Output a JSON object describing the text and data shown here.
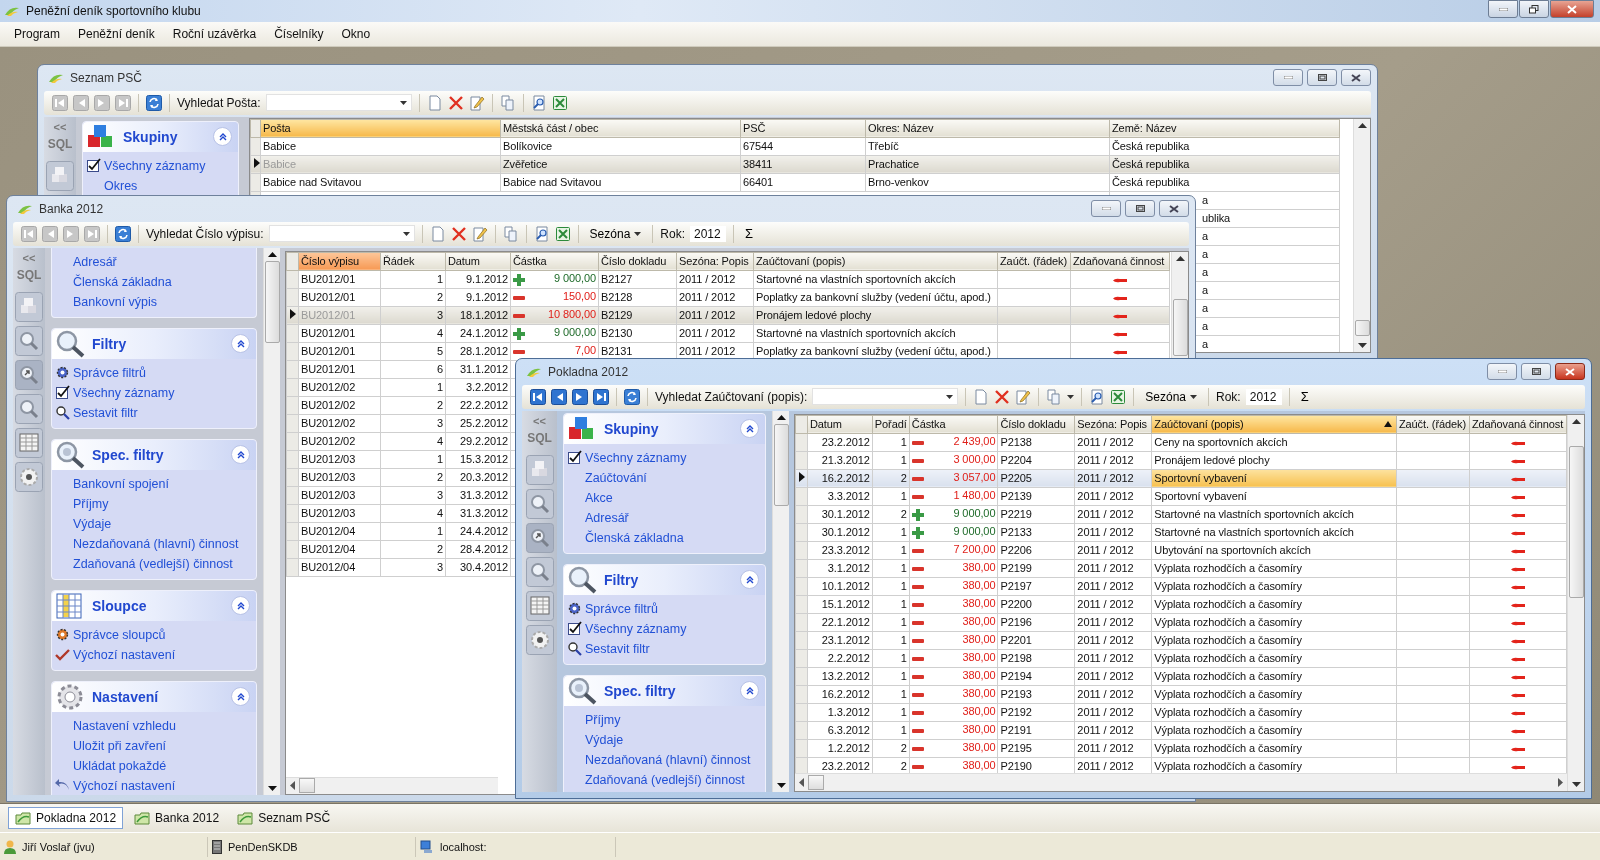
{
  "app": {
    "title": "Peněžní deník sportovního klubu"
  },
  "menu": [
    "Program",
    "Peněžní deník",
    "Roční uzávěrka",
    "Číselníky",
    "Okno"
  ],
  "windows": [
    {
      "title": "Seznam PSČ",
      "active": false,
      "toolbar": {
        "nav_enabled": false,
        "search_label": "Vyhledat Pošta:"
      },
      "strip": {
        "collapse": "<<",
        "sql": "SQL"
      },
      "sidebar": [
        {
          "kind": "groups",
          "title": "Skupiny",
          "expanded": true,
          "items": [
            {
              "kind": "check",
              "label": "Všechny záznamy",
              "checked": true
            },
            {
              "kind": "plain",
              "label": "Okres"
            }
          ]
        }
      ],
      "grid": {
        "columns": [
          {
            "label": "Pošta",
            "kind": "text",
            "active": true
          },
          {
            "label": "Městská část / obec",
            "kind": "text",
            "active": false
          },
          {
            "label": "PSČ",
            "kind": "text",
            "active": false
          },
          {
            "label": "Okres: Název",
            "kind": "text",
            "active": false
          },
          {
            "label": "Země: Název",
            "kind": "text",
            "active": false
          }
        ],
        "rows": [
          {
            "selected": false,
            "cells": [
              "Babice",
              "Bolíkovice",
              "67544",
              "Třebíč",
              "Česká republika"
            ]
          },
          {
            "selected": true,
            "cells": [
              "Babice",
              "Zvěřetice",
              "38411",
              "Prachatice",
              "Česká republika"
            ]
          },
          {
            "selected": false,
            "cells": [
              "Babice nad Svitavou",
              "Babice nad Svitavou",
              "66401",
              "Brno-venkov",
              "Česká republika"
            ]
          },
          {
            "selected": false,
            "tail": "a"
          },
          {
            "selected": false,
            "tail": "ublika"
          },
          {
            "selected": false,
            "tail": "a"
          },
          {
            "selected": false,
            "tail": "a"
          },
          {
            "selected": false,
            "tail": "a"
          },
          {
            "selected": false,
            "tail": "a"
          },
          {
            "selected": false,
            "tail": "a"
          },
          {
            "selected": false,
            "tail": "a"
          },
          {
            "selected": false,
            "tail": "a"
          }
        ]
      }
    },
    {
      "title": "Banka 2012",
      "active": false,
      "toolbar": {
        "nav_enabled": false,
        "search_label": "Vyhledat Číslo výpisu:",
        "season": "Sezóna",
        "year_label": "Rok:",
        "year": "2012",
        "sum": "Σ"
      },
      "strip": {
        "collapse": "<<",
        "sql": "SQL"
      },
      "sidebar": [
        {
          "items": [
            {
              "kind": "plain",
              "label": "Adresář"
            },
            {
              "kind": "plain",
              "label": "Členská základna"
            },
            {
              "kind": "plain",
              "label": "Bankovní výpis"
            }
          ]
        },
        {
          "kind": "filters",
          "title": "Filtry",
          "expanded": true,
          "items": [
            {
              "kind": "gears",
              "label": "Správce filtrů"
            },
            {
              "kind": "check",
              "label": "Všechny záznamy",
              "checked": true
            },
            {
              "kind": "search",
              "label": "Sestavit filtr"
            }
          ]
        },
        {
          "kind": "special",
          "title": "Spec. filtry",
          "expanded": true,
          "items": [
            {
              "kind": "plain",
              "label": "Bankovní spojení"
            },
            {
              "kind": "plain",
              "label": "Příjmy"
            },
            {
              "kind": "plain",
              "label": "Výdaje"
            },
            {
              "kind": "plain",
              "label": "Nezdaňovaná (hlavní) činnost"
            },
            {
              "kind": "plain",
              "label": "Zdaňovaná (vedlejší) činnost"
            }
          ]
        },
        {
          "kind": "columns",
          "title": "Sloupce",
          "expanded": true,
          "items": [
            {
              "kind": "colgear",
              "label": "Správce sloupců"
            },
            {
              "kind": "reset",
              "label": "Výchozí nastavení"
            }
          ]
        },
        {
          "kind": "settings",
          "title": "Nastavení",
          "expanded": true,
          "items": [
            {
              "kind": "plain",
              "label": "Nastavení vzhledu"
            },
            {
              "kind": "plain",
              "label": "Uložit při zavření"
            },
            {
              "kind": "plain",
              "label": "Ukládat pokaždé"
            },
            {
              "kind": "undo",
              "label": "Výchozí nastavení"
            }
          ]
        }
      ],
      "grid": {
        "columns": [
          {
            "label": "Číslo výpisu",
            "kind": "text",
            "active": true
          },
          {
            "label": "Řádek",
            "kind": "number",
            "active": false
          },
          {
            "label": "Datum",
            "kind": "number",
            "active": false
          },
          {
            "label": "Částka",
            "kind": "amount",
            "active": false
          },
          {
            "label": "Číslo dokladu",
            "kind": "text",
            "active": false
          },
          {
            "label": "Sezóna: Popis",
            "kind": "text",
            "active": false
          },
          {
            "label": "Zaúčtovaní (popis)",
            "kind": "text",
            "active": false
          },
          {
            "label": "Zaúčt. (řádek)",
            "kind": "text",
            "active": false
          },
          {
            "label": "Zdaňovaná činnost",
            "kind": "flag",
            "active": false
          }
        ],
        "rows": [
          {
            "selected": false,
            "cells": [
              "BU2012/01",
              "1",
              "9.1.2012",
              "9 000,00",
              "B2127",
              "2011 / 2012",
              "Startovné na vlastních sportovních akcích"
            ],
            "income": true,
            "taxed": false
          },
          {
            "selected": false,
            "cells": [
              "BU2012/01",
              "2",
              "9.1.2012",
              "150,00",
              "B2128",
              "2011 / 2012",
              "Poplatky za bankovní služby (vedení účtu, apod.)"
            ],
            "income": false,
            "taxed": false
          },
          {
            "selected": true,
            "cells": [
              "BU2012/01",
              "3",
              "18.1.2012",
              "10 800,00",
              "B2129",
              "2011 / 2012",
              "Pronájem ledové plochy"
            ],
            "income": false,
            "taxed": false
          },
          {
            "selected": false,
            "cells": [
              "BU2012/01",
              "4",
              "24.1.2012",
              "9 000,00",
              "B2130",
              "2011 / 2012",
              "Startovné na vlastních sportovních akcích"
            ],
            "income": true,
            "taxed": false
          },
          {
            "selected": false,
            "cells": [
              "BU2012/01",
              "5",
              "28.1.2012",
              "7,00",
              "B2131",
              "2011 / 2012",
              "Poplatky za bankovní služby (vedení účtu, apod.)"
            ],
            "income": false,
            "taxed": false
          },
          {
            "selected": false,
            "cells": [
              "BU2012/01",
              "6",
              "31.1.2012"
            ]
          },
          {
            "selected": false,
            "cells": [
              "BU2012/02",
              "1",
              "3.2.2012"
            ]
          },
          {
            "selected": false,
            "cells": [
              "BU2012/02",
              "2",
              "22.2.2012"
            ]
          },
          {
            "selected": false,
            "cells": [
              "BU2012/02",
              "3",
              "25.2.2012"
            ]
          },
          {
            "selected": false,
            "cells": [
              "BU2012/02",
              "4",
              "29.2.2012"
            ]
          },
          {
            "selected": false,
            "cells": [
              "BU2012/03",
              "1",
              "15.3.2012"
            ]
          },
          {
            "selected": false,
            "cells": [
              "BU2012/03",
              "2",
              "20.3.2012"
            ]
          },
          {
            "selected": false,
            "cells": [
              "BU2012/03",
              "3",
              "31.3.2012"
            ]
          },
          {
            "selected": false,
            "cells": [
              "BU2012/03",
              "4",
              "31.3.2012"
            ]
          },
          {
            "selected": false,
            "cells": [
              "BU2012/04",
              "1",
              "24.4.2012"
            ]
          },
          {
            "selected": false,
            "cells": [
              "BU2012/04",
              "2",
              "28.4.2012"
            ]
          },
          {
            "selected": false,
            "cells": [
              "BU2012/04",
              "3",
              "30.4.2012"
            ]
          }
        ]
      }
    },
    {
      "title": "Pokladna 2012",
      "active": true,
      "toolbar": {
        "nav_enabled": true,
        "search_label": "Vyhledat Zaúčtovaní (popis):",
        "copy_menu": true,
        "season": "Sezóna",
        "year_label": "Rok:",
        "year": "2012",
        "sum": "Σ"
      },
      "strip": {
        "collapse": "<<",
        "sql": "SQL"
      },
      "sidebar": [
        {
          "kind": "groups",
          "title": "Skupiny",
          "expanded": true,
          "items": [
            {
              "kind": "check",
              "label": "Všechny záznamy",
              "checked": true
            },
            {
              "kind": "plain",
              "label": "Zaúčtování"
            },
            {
              "kind": "plain",
              "label": "Akce"
            },
            {
              "kind": "plain",
              "label": "Adresář"
            },
            {
              "kind": "plain",
              "label": "Členská základna"
            }
          ]
        },
        {
          "kind": "filters",
          "title": "Filtry",
          "expanded": true,
          "items": [
            {
              "kind": "gears",
              "label": "Správce filtrů"
            },
            {
              "kind": "check",
              "label": "Všechny záznamy",
              "checked": true
            },
            {
              "kind": "search",
              "label": "Sestavit filtr"
            }
          ]
        },
        {
          "kind": "special",
          "title": "Spec. filtry",
          "expanded": true,
          "items": [
            {
              "kind": "plain",
              "label": "Příjmy"
            },
            {
              "kind": "plain",
              "label": "Výdaje"
            },
            {
              "kind": "plain",
              "label": "Nezdaňovaná (hlavní) činnost"
            },
            {
              "kind": "plain",
              "label": "Zdaňovaná (vedlejší) činnost"
            }
          ]
        }
      ],
      "grid": {
        "columns": [
          {
            "label": "Datum",
            "kind": "number",
            "active": false,
            "sorted": false
          },
          {
            "label": "Pořadí",
            "kind": "number",
            "active": false,
            "sorted": false
          },
          {
            "label": "Částka",
            "kind": "amount",
            "active": false,
            "sorted": false
          },
          {
            "label": "Číslo dokladu",
            "kind": "text",
            "active": false,
            "sorted": false
          },
          {
            "label": "Sezóna: Popis",
            "kind": "text",
            "active": false,
            "sorted": false
          },
          {
            "label": "Zaúčtovaní (popis)",
            "kind": "text",
            "active": true,
            "sorted": true
          },
          {
            "label": "Zaúčt. (řádek)",
            "kind": "text",
            "active": false,
            "sorted": false
          },
          {
            "label": "Zdaňovaná činnost",
            "kind": "flag",
            "active": false,
            "sorted": false
          }
        ],
        "rows": [
          {
            "selected": false,
            "cells": [
              "23.2.2012",
              "1",
              "2 439,00",
              "P2138",
              "2011 / 2012",
              "Ceny na sportovních akcích"
            ],
            "income": false,
            "taxed": false
          },
          {
            "selected": false,
            "cells": [
              "21.3.2012",
              "1",
              "3 000,00",
              "P2204",
              "2011 / 2012",
              "Pronájem ledové plochy"
            ],
            "income": false,
            "taxed": false
          },
          {
            "selected": true,
            "cells": [
              "16.2.2012",
              "2",
              "3 057,00",
              "P2205",
              "2011 / 2012",
              "Sportovní vybavení"
            ],
            "income": false,
            "taxed": false
          },
          {
            "selected": false,
            "cells": [
              "3.3.2012",
              "1",
              "1 480,00",
              "P2139",
              "2011 / 2012",
              "Sportovní vybavení"
            ],
            "income": false,
            "taxed": false
          },
          {
            "selected": false,
            "cells": [
              "30.1.2012",
              "2",
              "9 000,00",
              "P2219",
              "2011 / 2012",
              "Startovné na vlastních sportovních akcích"
            ],
            "income": true,
            "taxed": false
          },
          {
            "selected": false,
            "cells": [
              "30.1.2012",
              "1",
              "9 000,00",
              "P2133",
              "2011 / 2012",
              "Startovné na vlastních sportovních akcích"
            ],
            "income": true,
            "taxed": false
          },
          {
            "selected": false,
            "cells": [
              "23.3.2012",
              "1",
              "7 200,00",
              "P2206",
              "2011 / 2012",
              "Ubytování na sportovních akcích"
            ],
            "income": false,
            "taxed": false
          },
          {
            "selected": false,
            "cells": [
              "3.1.2012",
              "1",
              "380,00",
              "P2199",
              "2011 / 2012",
              "Výplata rozhodčích a časomíry"
            ],
            "income": false,
            "taxed": false
          },
          {
            "selected": false,
            "cells": [
              "10.1.2012",
              "1",
              "380,00",
              "P2197",
              "2011 / 2012",
              "Výplata rozhodčích a časomíry"
            ],
            "income": false,
            "taxed": false
          },
          {
            "selected": false,
            "cells": [
              "15.1.2012",
              "1",
              "380,00",
              "P2200",
              "2011 / 2012",
              "Výplata rozhodčích a časomíry"
            ],
            "income": false,
            "taxed": false
          },
          {
            "selected": false,
            "cells": [
              "22.1.2012",
              "1",
              "380,00",
              "P2196",
              "2011 / 2012",
              "Výplata rozhodčích a časomíry"
            ],
            "income": false,
            "taxed": false
          },
          {
            "selected": false,
            "cells": [
              "23.1.2012",
              "1",
              "380,00",
              "P2201",
              "2011 / 2012",
              "Výplata rozhodčích a časomíry"
            ],
            "income": false,
            "taxed": false
          },
          {
            "selected": false,
            "cells": [
              "2.2.2012",
              "1",
              "380,00",
              "P2198",
              "2011 / 2012",
              "Výplata rozhodčích a časomíry"
            ],
            "income": false,
            "taxed": false
          },
          {
            "selected": false,
            "cells": [
              "13.2.2012",
              "1",
              "380,00",
              "P2194",
              "2011 / 2012",
              "Výplata rozhodčích a časomíry"
            ],
            "income": false,
            "taxed": false
          },
          {
            "selected": false,
            "cells": [
              "16.2.2012",
              "1",
              "380,00",
              "P2193",
              "2011 / 2012",
              "Výplata rozhodčích a časomíry"
            ],
            "income": false,
            "taxed": false
          },
          {
            "selected": false,
            "cells": [
              "1.3.2012",
              "1",
              "380,00",
              "P2192",
              "2011 / 2012",
              "Výplata rozhodčích a časomíry"
            ],
            "income": false,
            "taxed": false
          },
          {
            "selected": false,
            "cells": [
              "6.3.2012",
              "1",
              "380,00",
              "P2191",
              "2011 / 2012",
              "Výplata rozhodčích a časomíry"
            ],
            "income": false,
            "taxed": false
          },
          {
            "selected": false,
            "cells": [
              "1.2.2012",
              "2",
              "380,00",
              "P2195",
              "2011 / 2012",
              "Výplata rozhodčích a časomíry"
            ],
            "income": false,
            "taxed": false
          },
          {
            "selected": false,
            "cells": [
              "23.2.2012",
              "2",
              "380,00",
              "P2190",
              "2011 / 2012",
              "Výplata rozhodčích a časomíry"
            ],
            "income": false,
            "taxed": false
          }
        ]
      }
    }
  ],
  "tabs": [
    {
      "label": "Pokladna 2012",
      "selected": true
    },
    {
      "label": "Banka 2012",
      "selected": false
    },
    {
      "label": "Seznam PSČ",
      "selected": false
    }
  ],
  "status": [
    {
      "kind": "user",
      "label": "Jiří Voslař (jvu)"
    },
    {
      "kind": "database",
      "label": "PenDenSKDB"
    },
    {
      "kind": "server",
      "label": "localhost:"
    }
  ]
}
